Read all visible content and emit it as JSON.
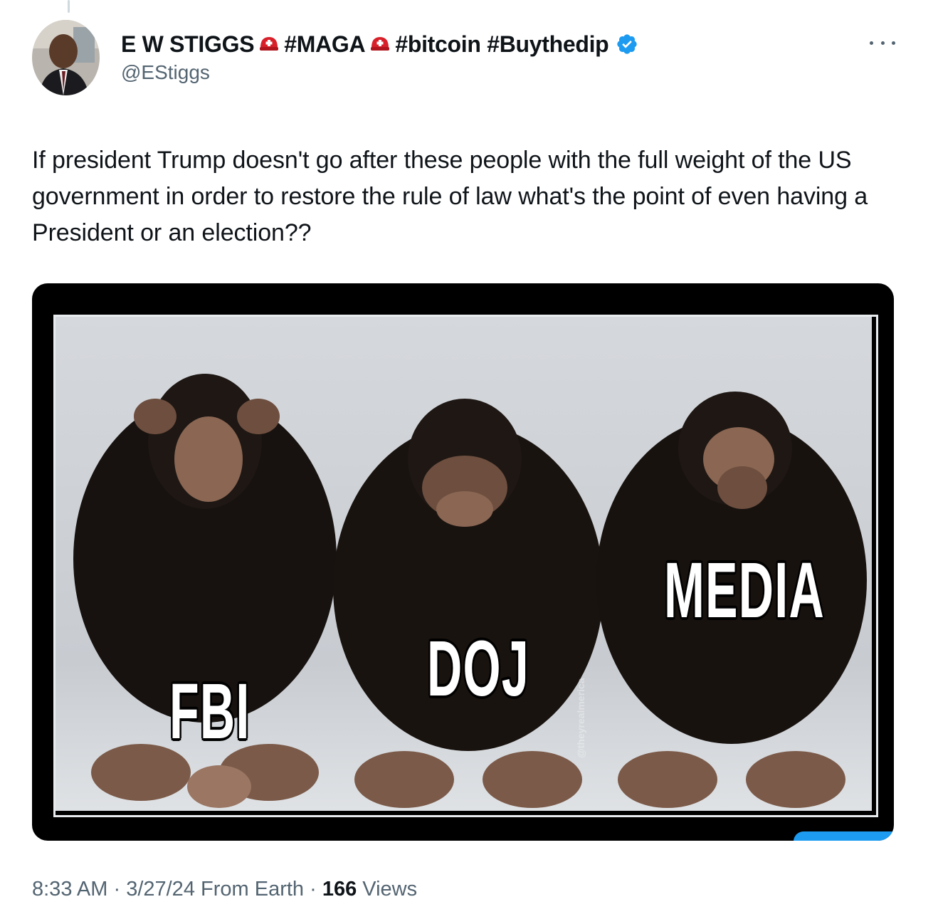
{
  "author": {
    "display_name_parts": [
      "E W STIGGS",
      "#MAGA",
      "#bitcoin #Buythedip"
    ],
    "handle": "@EStiggs",
    "verified": true,
    "avatar_icon": "profile-photo",
    "badge_icon": "red-helmet-emoji"
  },
  "tweet": {
    "text": "If president Trump doesn't go after these people with the full weight of the US government in order to restore the rule of law what's the point of  even having a President or an election??"
  },
  "media": {
    "labels": [
      "FBI",
      "DOJ",
      "MEDIA"
    ],
    "watermark": "@theyrealmerica"
  },
  "meta": {
    "time": "8:33 AM",
    "date": "3/27/24",
    "source": "From Earth",
    "views_count": "166",
    "views_label": "Views"
  },
  "colors": {
    "accent": "#1d9bf0",
    "muted": "#536471",
    "text": "#0f1419"
  }
}
